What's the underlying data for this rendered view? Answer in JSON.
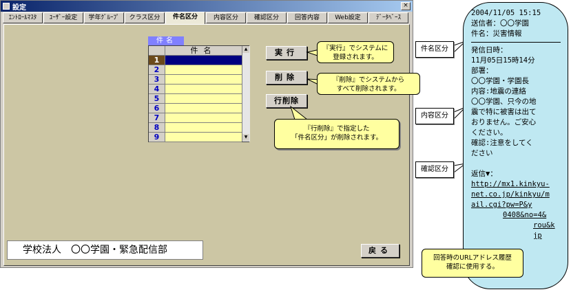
{
  "window": {
    "title": "設定",
    "close_glyph": "×",
    "tabs": [
      {
        "label": "ｴﾝﾄﾛｰﾙﾏｽﾀ",
        "active": false
      },
      {
        "label": "ﾕｰｻﾞｰ設定",
        "active": false
      },
      {
        "label": "学年ｸﾞﾙｰﾌﾟ",
        "active": false
      },
      {
        "label": "クラス区分",
        "active": false
      },
      {
        "label": "件名区分",
        "active": true
      },
      {
        "label": "内容区分",
        "active": false
      },
      {
        "label": "確認区分",
        "active": false
      },
      {
        "label": "回答内容",
        "active": false
      },
      {
        "label": "Web設定",
        "active": false
      },
      {
        "label": "ﾃﾞｰﾀﾍﾞｰｽ",
        "active": false
      }
    ]
  },
  "grid": {
    "tag": "件名",
    "column_header": "件名",
    "rows": [
      "1",
      "2",
      "3",
      "4",
      "5",
      "6",
      "7",
      "8",
      "9"
    ],
    "scroll_up": "▲",
    "scroll_down": "▼"
  },
  "buttons": {
    "exec": "実行",
    "delete": "削除",
    "row_delete": "行削除",
    "back": "戻る"
  },
  "footer": {
    "org_name": "学校法人　〇〇学園・緊急配信部"
  },
  "callouts": {
    "exec": [
      "『実行』でシステムに",
      "登録されます。"
    ],
    "delete": [
      "『削除』でシステムから",
      "すべて削除されます。"
    ],
    "row_delete": [
      "『行削除』で指定した",
      "「件名区分」が削除されます。"
    ],
    "url_history": [
      "回答時のURLアドレス履歴",
      "確認に使用する。"
    ]
  },
  "tags": {
    "subject": "件名区分",
    "content": "内容区分",
    "confirm": "確認区分"
  },
  "phone": {
    "header_lines": [
      "2004/11/05 15:15",
      "送信者：〇〇学園",
      "件名：災害情報"
    ],
    "body_lines": [
      "発信日時：",
      "11月05日15時14分",
      "部署：",
      "〇〇学園・学園長",
      "内容:地震の連絡",
      "〇〇学園、只今の地",
      "震で特に被害は出て",
      "おりません。ご安心",
      "ください。",
      "確認:注意をしてく",
      "ださい",
      "",
      "返信▼："
    ],
    "url_lines": [
      "http://mx1.kinkyu-",
      "net.co.jp/kinkyu/m",
      "ail.cgi?pw=P&y",
      "0408&no=4&",
      "rou&k",
      "jp"
    ]
  },
  "colors": {
    "panel": "#ccc6a4",
    "grid_cell": "#ffffa8",
    "grid_selected": "#000080",
    "callout": "#ffffa0",
    "phone": "#bfe8f2",
    "title_bar": "#0a246a"
  }
}
